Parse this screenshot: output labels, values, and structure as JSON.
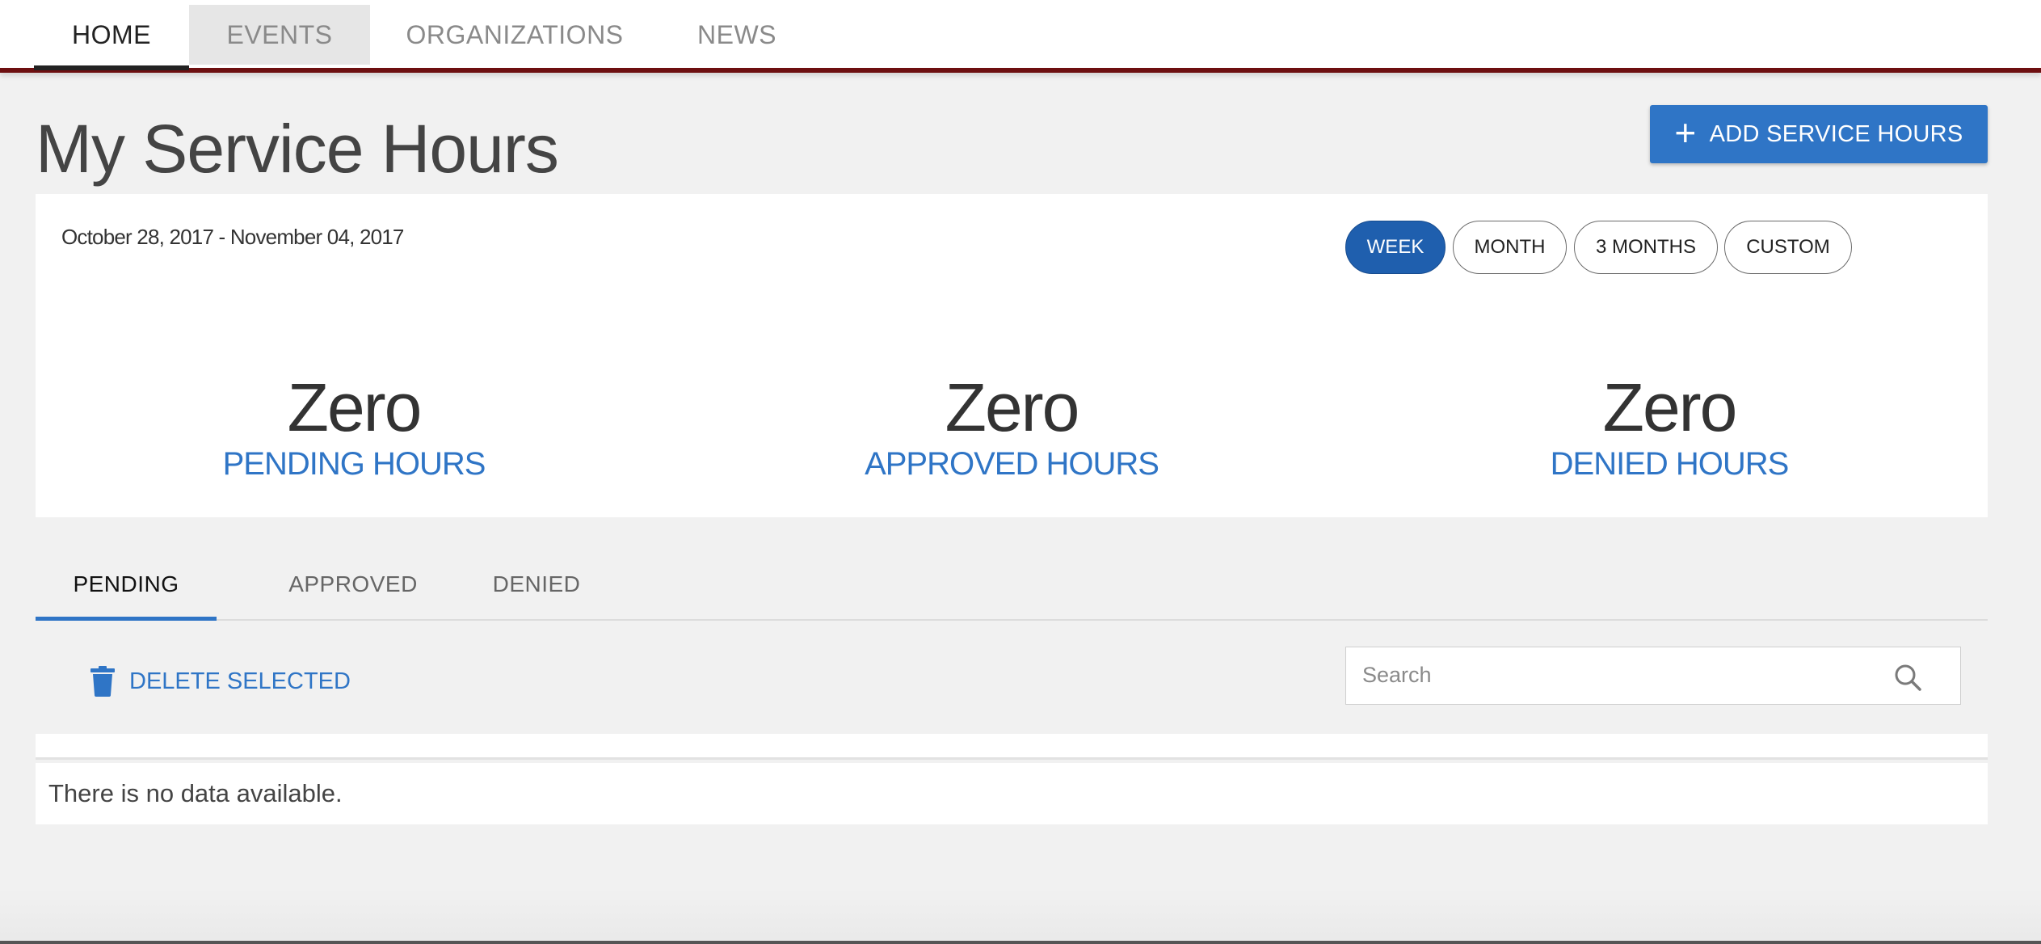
{
  "nav": {
    "tabs": [
      "HOME",
      "EVENTS",
      "ORGANIZATIONS",
      "NEWS"
    ],
    "active": "HOME",
    "accent_color": "#6d0f10"
  },
  "page": {
    "title": "My Service Hours",
    "add_button_label": "ADD SERVICE HOURS"
  },
  "summary": {
    "date_range": "October 28, 2017 - November 04, 2017",
    "ranges": [
      "WEEK",
      "MONTH",
      "3 MONTHS",
      "CUSTOM"
    ],
    "active_range": "WEEK",
    "stats": [
      {
        "value": "Zero",
        "label": "PENDING HOURS"
      },
      {
        "value": "Zero",
        "label": "APPROVED HOURS"
      },
      {
        "value": "Zero",
        "label": "DENIED HOURS"
      }
    ]
  },
  "tabs": {
    "items": [
      "PENDING",
      "APPROVED",
      "DENIED"
    ],
    "active": "PENDING"
  },
  "toolbar": {
    "delete_label": "DELETE SELECTED",
    "search_placeholder": "Search"
  },
  "table": {
    "empty_message": "There is no data available."
  },
  "colors": {
    "primary": "#2f75c6",
    "active_pill": "#1f5fae"
  }
}
